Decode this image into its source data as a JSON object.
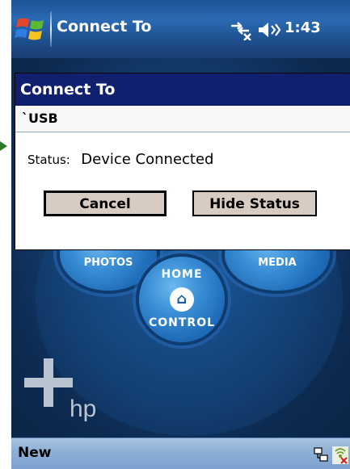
{
  "titlebar": {
    "app_title": "Connect To",
    "clock": "1:43",
    "icons": [
      "start-logo-icon",
      "connectivity-icon",
      "volume-icon"
    ]
  },
  "dialog": {
    "title": "Connect To",
    "connection_name": "`USB",
    "status_label": "Status:",
    "status_value": "Device Connected",
    "cancel_label": "Cancel",
    "hide_status_label": "Hide Status"
  },
  "today": {
    "photos_label": "PHOTOS",
    "media_label": "MEDIA",
    "home_top_label": "HOME",
    "home_bottom_label": "CONTROL",
    "brand": "hp"
  },
  "bottombar": {
    "softkey_left": "New",
    "icons": [
      "network-icon",
      "wireless-icon"
    ]
  },
  "colors": {
    "titlebar": "#1d4f8c",
    "dialog_title": "#10206f",
    "button_face": "#d8cbc1",
    "bottombar": "#8eb0d7"
  }
}
